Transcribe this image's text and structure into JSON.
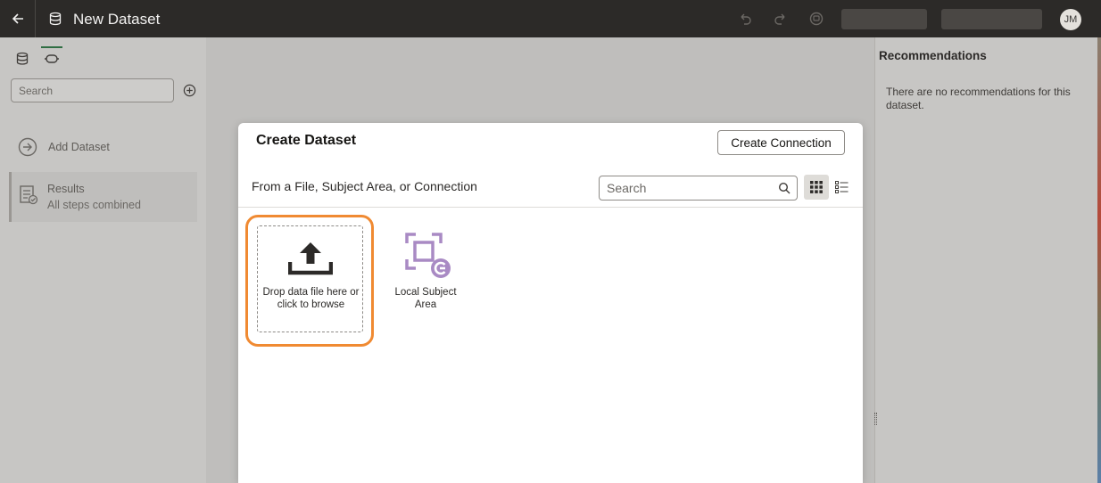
{
  "header": {
    "title": "New Dataset",
    "avatar_initials": "JM"
  },
  "left_panel": {
    "search_placeholder": "Search",
    "add_dataset_label": "Add Dataset",
    "results": {
      "title": "Results",
      "subtitle": "All steps combined"
    }
  },
  "right_panel": {
    "title": "Recommendations",
    "message": "There are no recommendations for this dataset."
  },
  "dialog": {
    "title": "Create Dataset",
    "create_connection_label": "Create Connection",
    "subtitle": "From a File, Subject Area, or Connection",
    "search_placeholder": "Search",
    "tiles": [
      {
        "label": "Drop data file here or click to browse",
        "icon": "upload-icon"
      },
      {
        "label": "Local Subject Area",
        "icon": "local-subject-area-icon"
      }
    ]
  },
  "colors": {
    "topbar": "#2c2a28",
    "highlight": "#f08a32",
    "subject_area_purple": "#a98ac4",
    "active_tab_green": "#2f6e43"
  }
}
